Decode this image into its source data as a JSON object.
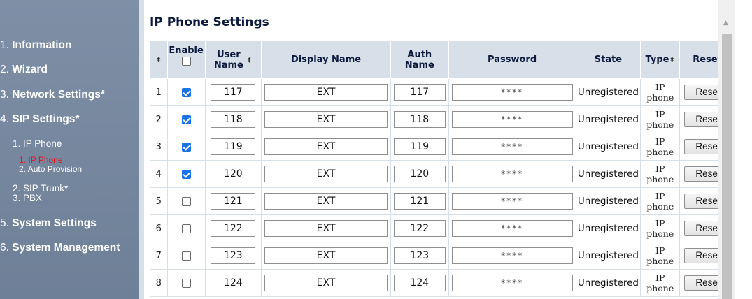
{
  "sidebar": {
    "items": [
      {
        "num": "1.",
        "label": "Information"
      },
      {
        "num": "2.",
        "label": "Wizard"
      },
      {
        "num": "3.",
        "label": "Network Settings*"
      },
      {
        "num": "4.",
        "label": "SIP Settings*"
      },
      {
        "num": "5.",
        "label": "System Settings"
      },
      {
        "num": "6.",
        "label": "System Management"
      }
    ],
    "sip_sub": [
      {
        "num": "1.",
        "label": "IP Phone"
      },
      {
        "num": "2.",
        "label": "SIP Trunk*"
      },
      {
        "num": "3.",
        "label": "PBX"
      }
    ],
    "ipphone_sub": [
      {
        "num": "1.",
        "label": "IP Phone"
      },
      {
        "num": "2.",
        "label": "Auto Provision"
      }
    ]
  },
  "page": {
    "title": "IP Phone Settings"
  },
  "table": {
    "headers": {
      "sort_icon": "⬍",
      "enable": "Enable",
      "user_name_1": "User",
      "user_name_2": "Name",
      "display_name": "Display Name",
      "auth_name_1": "Auth",
      "auth_name_2": "Name",
      "password": "Password",
      "state": "State",
      "type": "Type",
      "reset": "Reset"
    },
    "rows": [
      {
        "idx": "1",
        "enabled": true,
        "user": "117",
        "display": "EXT",
        "auth": "117",
        "password": "****",
        "state": "Unregistered",
        "type1": "IP",
        "type2": "phone",
        "reset": "Reset"
      },
      {
        "idx": "2",
        "enabled": true,
        "user": "118",
        "display": "EXT",
        "auth": "118",
        "password": "****",
        "state": "Unregistered",
        "type1": "IP",
        "type2": "phone",
        "reset": "Reset"
      },
      {
        "idx": "3",
        "enabled": true,
        "user": "119",
        "display": "EXT",
        "auth": "119",
        "password": "****",
        "state": "Unregistered",
        "type1": "IP",
        "type2": "phone",
        "reset": "Reset"
      },
      {
        "idx": "4",
        "enabled": true,
        "user": "120",
        "display": "EXT",
        "auth": "120",
        "password": "****",
        "state": "Unregistered",
        "type1": "IP",
        "type2": "phone",
        "reset": "Reset"
      },
      {
        "idx": "5",
        "enabled": false,
        "user": "121",
        "display": "EXT",
        "auth": "121",
        "password": "****",
        "state": "Unregistered",
        "type1": "IP",
        "type2": "phone",
        "reset": "Reset"
      },
      {
        "idx": "6",
        "enabled": false,
        "user": "122",
        "display": "EXT",
        "auth": "122",
        "password": "****",
        "state": "Unregistered",
        "type1": "IP",
        "type2": "phone",
        "reset": "Reset"
      },
      {
        "idx": "7",
        "enabled": false,
        "user": "123",
        "display": "EXT",
        "auth": "123",
        "password": "****",
        "state": "Unregistered",
        "type1": "IP",
        "type2": "phone",
        "reset": "Reset"
      },
      {
        "idx": "8",
        "enabled": false,
        "user": "124",
        "display": "EXT",
        "auth": "124",
        "password": "****",
        "state": "Unregistered",
        "type1": "IP",
        "type2": "phone",
        "reset": "Reset"
      }
    ]
  },
  "colors": {
    "sidebar_bg": "#7e8fa6",
    "header_bg": "#d7dfe8",
    "active_link": "#e8101a",
    "checkbox": "#1a73e8"
  }
}
